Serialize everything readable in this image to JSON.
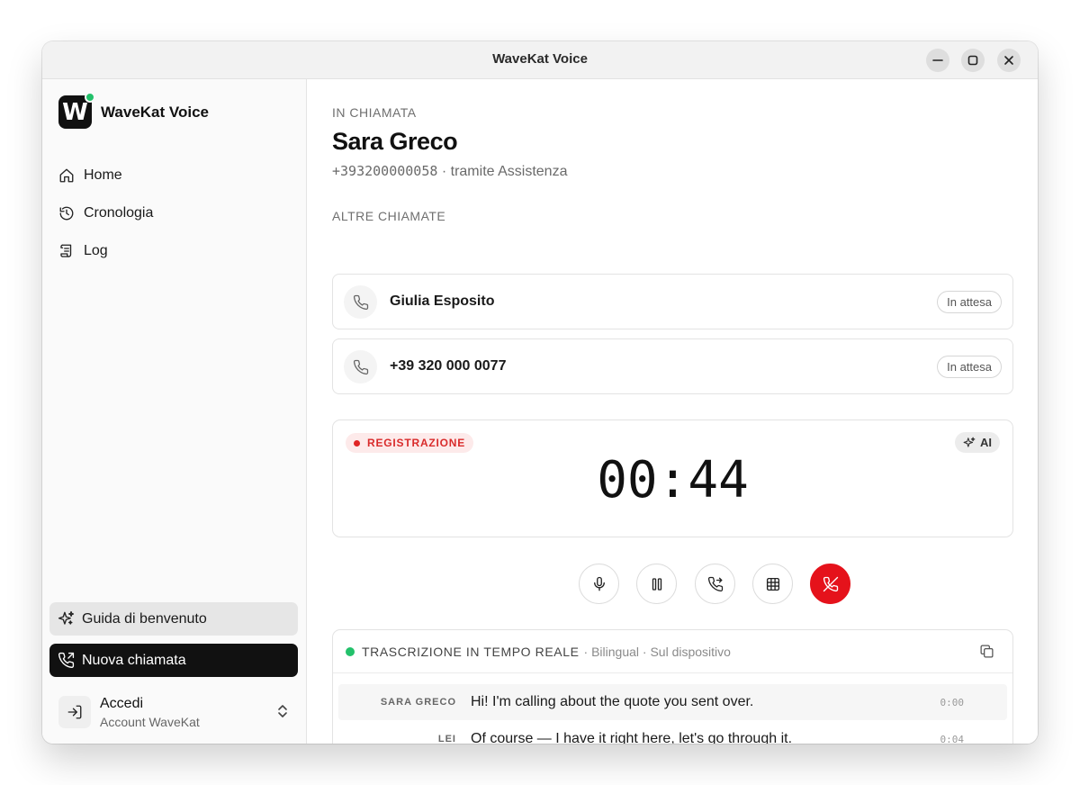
{
  "window": {
    "title": "WaveKat Voice"
  },
  "sidebar": {
    "brand": {
      "logo_letter": "W",
      "name": "WaveKat Voice"
    },
    "nav": [
      {
        "label": "Home",
        "icon": "home-icon"
      },
      {
        "label": "Cronologia",
        "icon": "history-icon"
      },
      {
        "label": "Log",
        "icon": "scroll-icon"
      }
    ],
    "guide_button": {
      "label": "Guida di benvenuto",
      "icon": "sparkles-icon"
    },
    "new_call_button": {
      "label": "Nuova chiamata",
      "icon": "phone-outgoing-icon"
    },
    "account": {
      "title": "Accedi",
      "subtitle": "Account WaveKat"
    }
  },
  "call": {
    "status_label": "IN CHIAMATA",
    "caller_name": "Sara Greco",
    "caller_number": "+393200000058",
    "via": "· tramite Assistenza"
  },
  "other_calls": {
    "label": "ALTRE CHIAMATE",
    "items": [
      {
        "name": "Giulia Esposito",
        "status": "In attesa"
      },
      {
        "name": "+39 320 000 0077",
        "status": "In attesa"
      }
    ]
  },
  "recording": {
    "badge": "REGISTRAZIONE",
    "ai_badge": "AI",
    "timer": "00:44"
  },
  "controls": [
    "mic-icon",
    "pause-icon",
    "transfer-call-icon",
    "keypad-icon",
    "hang-up-icon"
  ],
  "transcript": {
    "title": "TRASCRIZIONE IN TEMPO REALE",
    "meta": "· Bilingual · Sul dispositivo",
    "lines": [
      {
        "speaker": "SARA GRECO",
        "text": "Hi! I'm calling about the quote you sent over.",
        "time": "0:00"
      },
      {
        "speaker": "LEI",
        "text": "Of course — I have it right here, let's go through it.",
        "time": "0:04"
      }
    ]
  },
  "colors": {
    "accent_green": "#23c16b",
    "recording_red": "#d92b2b",
    "hangup_red": "#e5121b",
    "primary_dark": "#111111"
  }
}
